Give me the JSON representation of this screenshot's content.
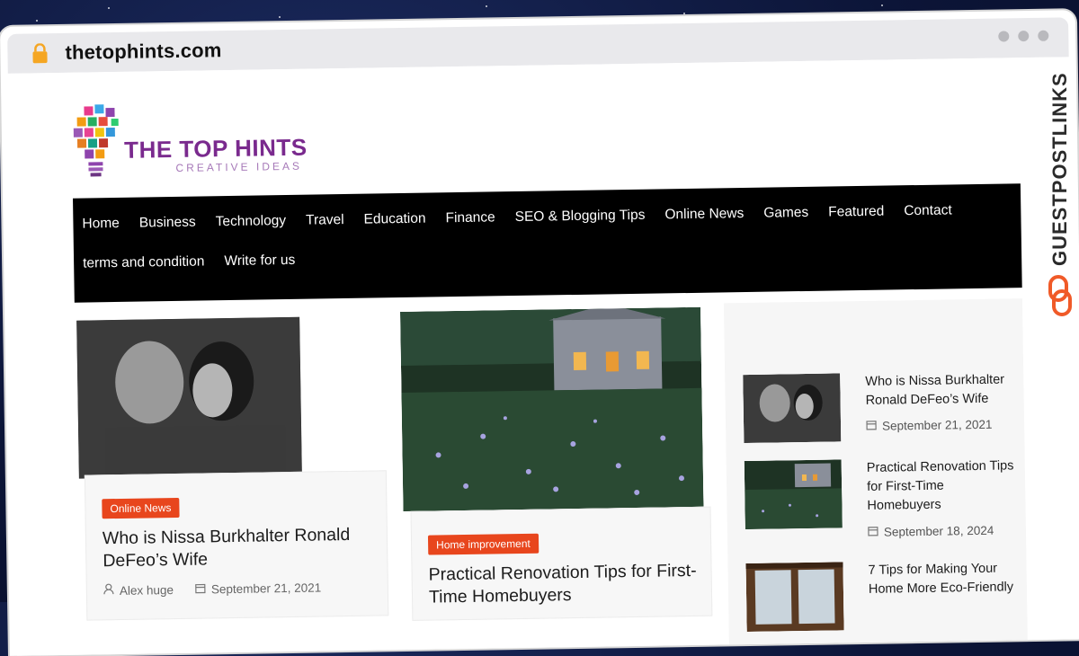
{
  "browser": {
    "url": "thetophints.com"
  },
  "site": {
    "logo_title": "THE TOP HINTS",
    "logo_subtitle": "CREATIVE IDEAS"
  },
  "nav": {
    "items": [
      "Home",
      "Business",
      "Technology",
      "Travel",
      "Education",
      "Finance",
      "SEO & Blogging Tips",
      "Online News",
      "Games",
      "Featured",
      "Contact",
      "terms and condition",
      "Write for us"
    ]
  },
  "posts": [
    {
      "category": "Online News",
      "title": "Who is Nissa Burkhalter Ronald DeFeo’s Wife",
      "author": "Alex huge",
      "date": "September 21, 2021"
    },
    {
      "category": "Home improvement",
      "title": "Practical Renovation Tips for First-Time Homebuyers"
    }
  ],
  "sidebar": {
    "items": [
      {
        "title": "Who is Nissa Burkhalter Ronald DeFeo’s Wife",
        "date": "September 21, 2021"
      },
      {
        "title": "Practical Renovation Tips for First-Time Homebuyers",
        "date": "September 18, 2024"
      },
      {
        "title": "7 Tips for Making Your Home More Eco-Friendly"
      }
    ]
  },
  "watermark": {
    "text": "GUESTPOSTLINKS",
    "color": "#f05a28"
  },
  "colors": {
    "accent": "#e8461d",
    "nav_bg": "#000000",
    "logo_purple": "#7a2a8e"
  }
}
